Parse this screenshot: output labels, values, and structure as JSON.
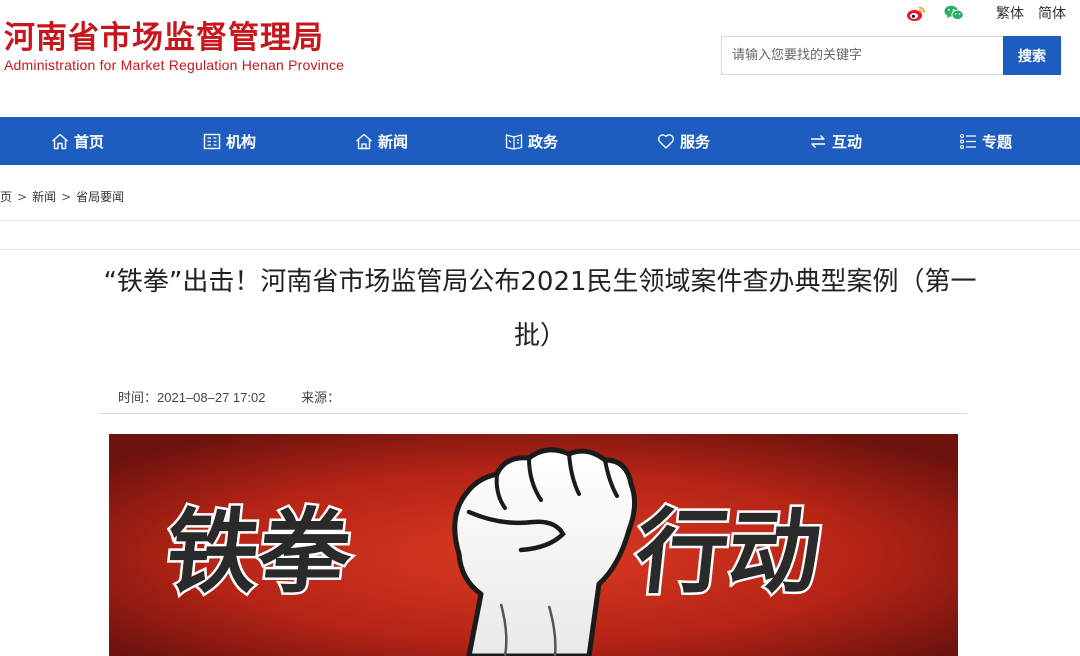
{
  "header": {
    "logo_cn": "河南省市场监督管理局",
    "logo_en": "Administration for Market Regulation Henan Province",
    "social": [
      "weibo-icon",
      "wechat-icon"
    ],
    "lang_traditional": "繁体",
    "lang_simplified": "简体",
    "search_placeholder": "请输入您要找的关键字",
    "search_button": "搜索"
  },
  "nav": {
    "items": [
      {
        "label": "首页",
        "icon": "home-icon"
      },
      {
        "label": "机构",
        "icon": "building-icon"
      },
      {
        "label": "新闻",
        "icon": "news-icon"
      },
      {
        "label": "政务",
        "icon": "affairs-icon"
      },
      {
        "label": "服务",
        "icon": "heart-icon"
      },
      {
        "label": "互动",
        "icon": "exchange-icon"
      },
      {
        "label": "专题",
        "icon": "topics-icon"
      }
    ]
  },
  "breadcrumb": [
    "页",
    "新闻",
    "省局要闻"
  ],
  "article": {
    "title_line1": "“铁拳”出击！河南省市场监管局公布2021民生领域案件查办典型案例（第一",
    "title_line2": "批）",
    "time_label": "时间：",
    "time_value": "2021–08–27 17:02",
    "source_label": "来源："
  },
  "banner": {
    "text_left": "铁拳",
    "text_right": "行动",
    "colors": {
      "bg_center": "#d8321f",
      "bg_edge": "#7a1410"
    }
  },
  "colors": {
    "brand_red": "#c8161d",
    "nav_blue": "#1d5dbf"
  }
}
